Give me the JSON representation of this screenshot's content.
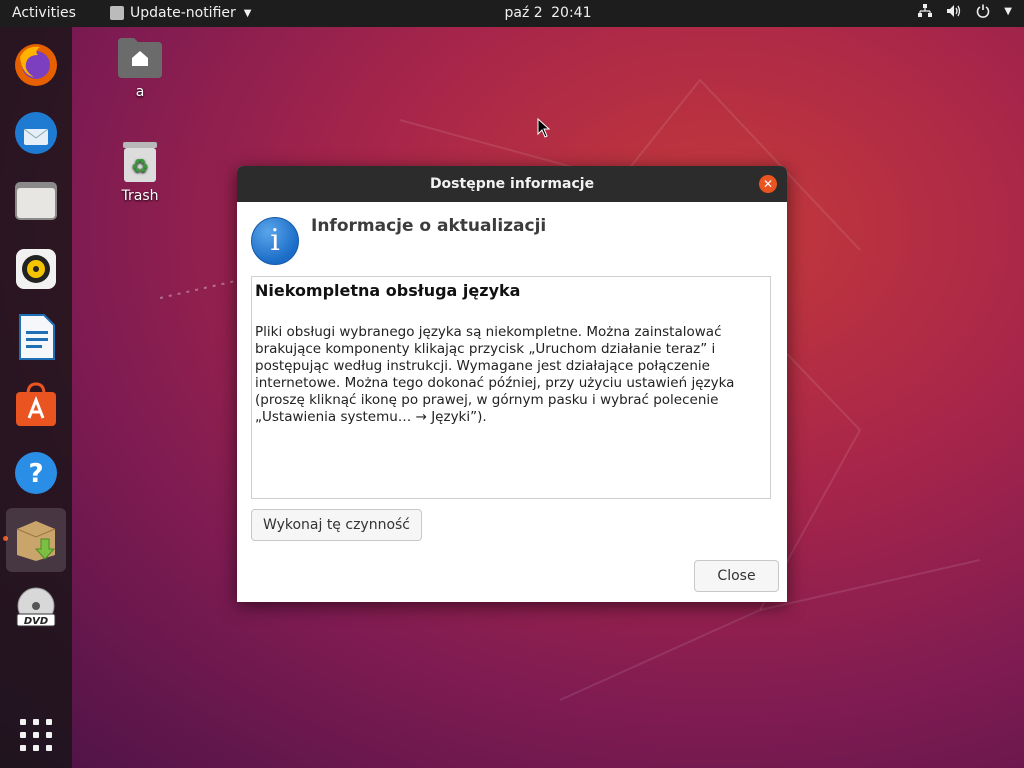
{
  "topbar": {
    "activities": "Activities",
    "app_name": "Update-notifier",
    "date": "paź 2",
    "time": "20:41"
  },
  "dock": {
    "items": [
      {
        "name": "firefox-icon"
      },
      {
        "name": "thunderbird-icon"
      },
      {
        "name": "files-icon"
      },
      {
        "name": "rhythmbox-icon"
      },
      {
        "name": "libreoffice-writer-icon"
      },
      {
        "name": "software-center-icon"
      },
      {
        "name": "help-icon"
      },
      {
        "name": "package-installer-icon",
        "active": true
      },
      {
        "name": "dvd-icon"
      },
      {
        "name": "show-apps-icon"
      }
    ]
  },
  "desktop": {
    "home_label": "a",
    "trash_label": "Trash"
  },
  "dialog": {
    "title": "Dostępne informacje",
    "header": "Informacje o aktualizacji",
    "content_heading": "Niekompletna obsługa języka",
    "content_lines": [
      "Pliki obsługi wybranego języka są niekompletne. Można zainstalować",
      "brakujące komponenty klikając przycisk „Uruchom działanie teraz” i",
      "postępując według instrukcji. Wymagane jest działające połączenie",
      "internetowe. Można tego dokonać później, przy użyciu ustawień języka",
      "(proszę kliknąć ikonę po prawej, w górnym pasku i wybrać polecenie",
      "„Ustawienia systemu… → Języki”)."
    ],
    "action_button": "Wykonaj tę czynność",
    "close_button": "Close"
  },
  "colors": {
    "accent": "#e95420",
    "topbar": "#1d1d1d",
    "titlebar": "#2c2c2c"
  }
}
